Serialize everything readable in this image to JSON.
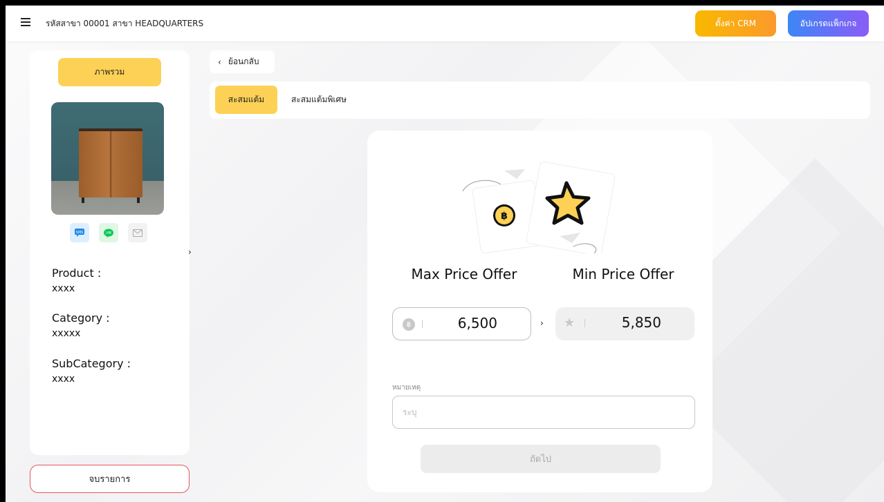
{
  "header": {
    "branch_text": "รหัสสาขา 00001 สาขา HEADQUARTERS",
    "crm_button": "ตั้งค่า CRM",
    "upgrade_button": "อัปเกรดแพ็กเกจ"
  },
  "sidebar": {
    "overview_button": "ภาพรวม",
    "share_icons": [
      "sms-icon",
      "line-icon",
      "mail-icon"
    ],
    "product_label": "Product :",
    "product_value": "xxxx",
    "category_label": "Category :",
    "category_value": "xxxxx",
    "subcategory_label": "SubCategory :",
    "subcategory_value": "xxxx",
    "end_button": "จบรายการ"
  },
  "main": {
    "back_button": "ย้อนกลับ",
    "tabs": [
      {
        "label": "สะสมแต้ม",
        "active": true
      },
      {
        "label": "สะสมแต้มพิเศษ",
        "active": false
      }
    ],
    "max_price_label": "Max Price Offer",
    "min_price_label": "Min Price Offer",
    "max_price_value": "6,500",
    "min_price_value": "5,850",
    "note_label": "หมายเหตุ",
    "note_placeholder": "ระบุ",
    "next_button": "ถัดไป"
  },
  "colors": {
    "accent_yellow": "#fcd155",
    "crm_orange": "#f9b800",
    "upgrade_blue": "#3e86f5",
    "danger_red": "#e4565a"
  }
}
